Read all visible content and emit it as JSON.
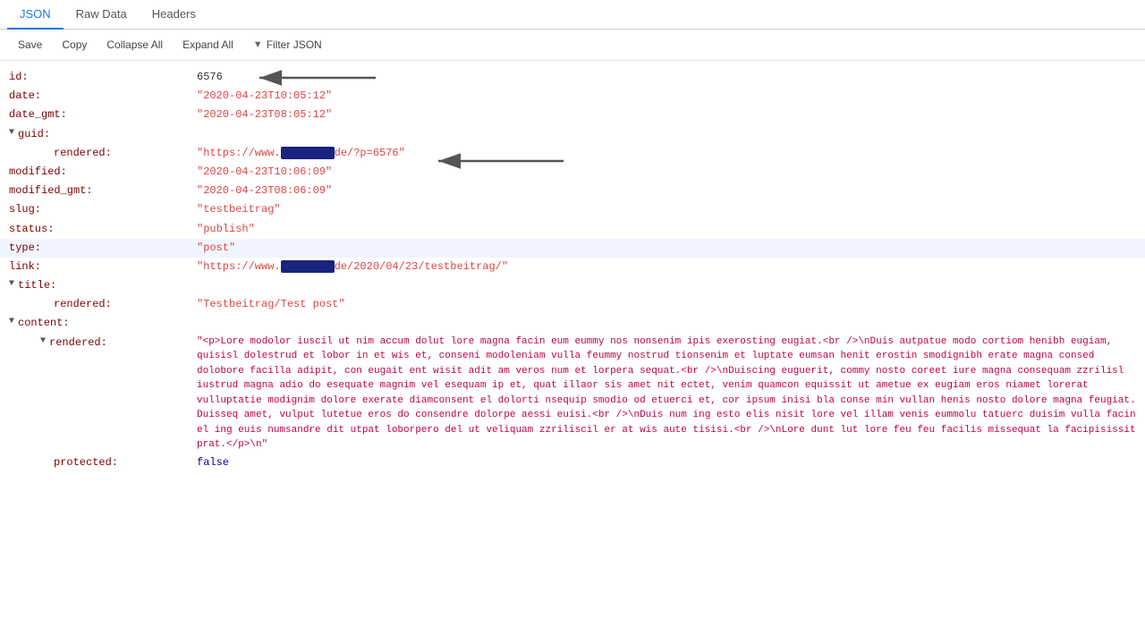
{
  "tabs": [
    {
      "label": "JSON",
      "active": true
    },
    {
      "label": "Raw Data",
      "active": false
    },
    {
      "label": "Headers",
      "active": false
    }
  ],
  "toolbar": {
    "save": "Save",
    "copy": "Copy",
    "collapse_all": "Collapse All",
    "expand_all": "Expand All",
    "filter": "Filter JSON"
  },
  "json_data": {
    "id_key": "id:",
    "id_val": "6576",
    "date_key": "date:",
    "date_val": "\"2020-04-23T10:05:12\"",
    "date_gmt_key": "date_gmt:",
    "date_gmt_val": "\"2020-04-23T08:05:12\"",
    "guid_key": "guid:",
    "rendered_key": "rendered:",
    "rendered_val_prefix": "\"https://www.",
    "rendered_val_suffix": "de/?p=6576\"",
    "modified_key": "modified:",
    "modified_val": "\"2020-04-23T10:06:09\"",
    "modified_gmt_key": "modified_gmt:",
    "modified_gmt_val": "\"2020-04-23T08:06:09\"",
    "slug_key": "slug:",
    "slug_val": "\"testbeitrag\"",
    "status_key": "status:",
    "status_val": "\"publish\"",
    "type_key": "type:",
    "type_val": "\"post\"",
    "link_key": "link:",
    "link_val_prefix": "\"https://www.",
    "link_val_suffix": "de/2020/04/23/testbeitrag/\"",
    "title_key": "title:",
    "title_rendered_key": "rendered:",
    "title_rendered_val": "\"Testbeitrag/Test post\"",
    "content_key": "content:",
    "content_rendered_key": "rendered:",
    "content_rendered_val": "\"<p>Lore modolor iuscil ut nim accum dolut lore magna facin eum eummy nos nonsenim ipis exerosting eugiat.<br />\\nDuis autpatue modo cortiom henibh eugiam, quisisl dolestrud et lobor in et wis et, conseni modoleniam vulla feummy nostrud tionsenim et luptate eumsan henit erostin smodignibh erate magna consed dolobore facilla adipit, con eugait ent wisit adit am veros num et lorpera sequat.<br />\\nDuiscing euguerit, commy nosto coreet iure magna consequam zzrilisl iustrud magna adio do esequate magnim vel esequam ip et, quat illaor sis amet nit ectet, venim quamcon equissit ut ametue ex eugiam eros niamet lorerat vulluptatie modignim dolore exerate diamconsent el dolorti nsequip smodio od etuerci et, cor ipsum inisi bla conse min vullan henis nosto dolore magna feugiat. Duisseq amet, vulput lutetue eros do consendre dolorpe aessi euisi.<br />\\nDuis num ing esto elis nisit lore vel illam venis eummolu tatuerc duisim vulla facin el ing euis numsandre dit utpat loborpero del ut veliquam zzriliscil er at wis aute tisisi.<br />\\nLore dunt lut lore feu feu facilis missequat la facipisissit prat.</p>\\n\"",
    "protected_key": "protected:",
    "protected_val": "false"
  }
}
